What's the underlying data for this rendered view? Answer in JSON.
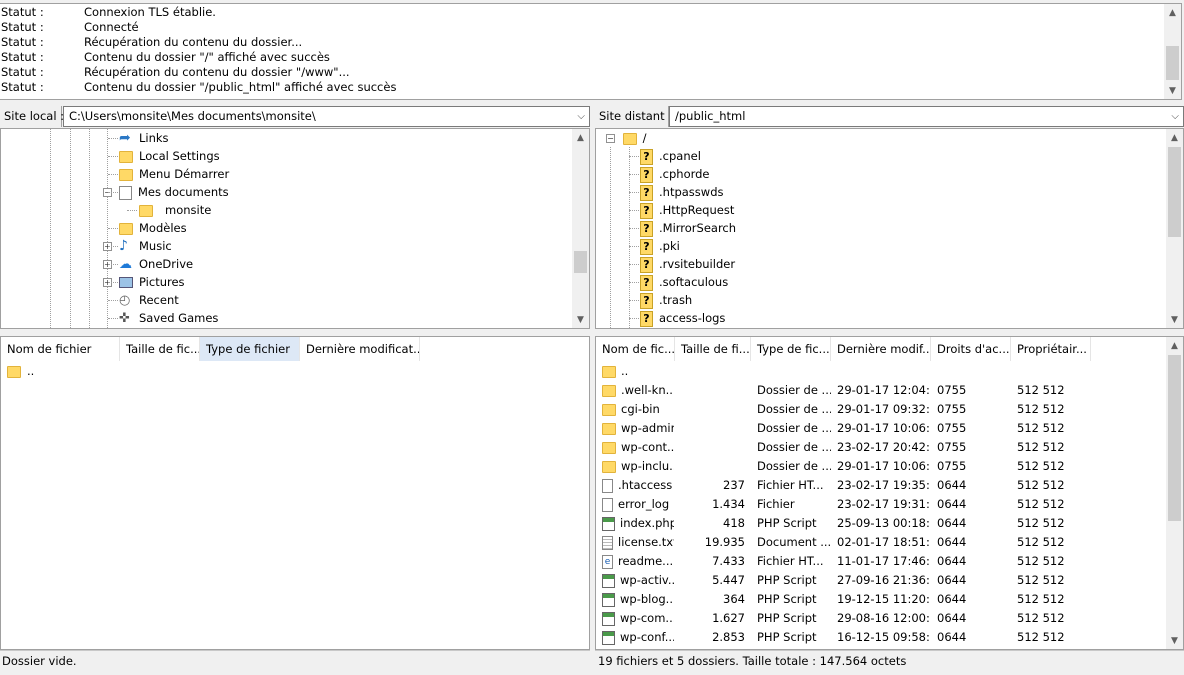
{
  "log": [
    {
      "key": "Statut :",
      "msg": "Connexion TLS établie."
    },
    {
      "key": "Statut :",
      "msg": "Connecté"
    },
    {
      "key": "Statut :",
      "msg": "Récupération du contenu du dossier..."
    },
    {
      "key": "Statut :",
      "msg": "Contenu du dossier \"/\" affiché avec succès"
    },
    {
      "key": "Statut :",
      "msg": "Récupération du contenu du dossier \"/www\"..."
    },
    {
      "key": "Statut :",
      "msg": "Contenu du dossier \"/public_html\" affiché avec succès"
    }
  ],
  "local": {
    "label": "Site local :",
    "path": "C:\\Users\\monsite\\Mes documents\\monsite\\",
    "tree": [
      {
        "label": "Links",
        "icon": "links-icon"
      },
      {
        "label": "Local Settings",
        "icon": "folder-icon"
      },
      {
        "label": "Menu Démarrer",
        "icon": "folder-icon"
      },
      {
        "label": "Mes documents",
        "icon": "documents-icon"
      },
      {
        "label": "monsite",
        "icon": "folder-icon"
      },
      {
        "label": "Modèles",
        "icon": "folder-icon"
      },
      {
        "label": "Music",
        "icon": "music-icon"
      },
      {
        "label": "OneDrive",
        "icon": "onedrive-icon"
      },
      {
        "label": "Pictures",
        "icon": "pictures-icon"
      },
      {
        "label": "Recent",
        "icon": "recent-icon"
      },
      {
        "label": "Saved Games",
        "icon": "saved-games-icon"
      }
    ],
    "columns": [
      "Nom de fichier",
      "Taille de fic...",
      "Type de fichier",
      "Dernière modificat..."
    ],
    "files": [
      ".."
    ],
    "status": "Dossier vide."
  },
  "remote": {
    "label": "Site distant :",
    "path": "/public_html",
    "tree_root": "/",
    "tree": [
      ".cpanel",
      ".cphorde",
      ".htpasswds",
      ".HttpRequest",
      ".MirrorSearch",
      ".pki",
      ".rvsitebuilder",
      ".softaculous",
      ".trash",
      "access-logs"
    ],
    "columns": [
      "Nom de fic...",
      "Taille de fi...",
      "Type de fic...",
      "Dernière modif...",
      "Droits d'ac...",
      "Propriétair..."
    ],
    "files": [
      {
        "name": "..",
        "size": "",
        "type": "",
        "date": "",
        "perm": "",
        "owner": "",
        "icon": "folder-icon"
      },
      {
        "name": ".well-kn...",
        "size": "",
        "type": "Dossier de ...",
        "date": "29-01-17 12:04:...",
        "perm": "0755",
        "owner": "512 512",
        "icon": "folder-icon"
      },
      {
        "name": "cgi-bin",
        "size": "",
        "type": "Dossier de ...",
        "date": "29-01-17 09:32:...",
        "perm": "0755",
        "owner": "512 512",
        "icon": "folder-icon"
      },
      {
        "name": "wp-admin",
        "size": "",
        "type": "Dossier de ...",
        "date": "29-01-17 10:06:...",
        "perm": "0755",
        "owner": "512 512",
        "icon": "folder-icon"
      },
      {
        "name": "wp-cont...",
        "size": "",
        "type": "Dossier de ...",
        "date": "23-02-17 20:42:...",
        "perm": "0755",
        "owner": "512 512",
        "icon": "folder-icon"
      },
      {
        "name": "wp-inclu...",
        "size": "",
        "type": "Dossier de ...",
        "date": "29-01-17 10:06:...",
        "perm": "0755",
        "owner": "512 512",
        "icon": "folder-icon"
      },
      {
        "name": ".htaccess",
        "size": "237",
        "type": "Fichier HT...",
        "date": "23-02-17 19:35:...",
        "perm": "0644",
        "owner": "512 512",
        "icon": "file-icon"
      },
      {
        "name": "error_log",
        "size": "1.434",
        "type": "Fichier",
        "date": "23-02-17 19:31:...",
        "perm": "0644",
        "owner": "512 512",
        "icon": "file-icon"
      },
      {
        "name": "index.php",
        "size": "418",
        "type": "PHP Script",
        "date": "25-09-13 00:18:...",
        "perm": "0644",
        "owner": "512 512",
        "icon": "php-icon"
      },
      {
        "name": "license.txt",
        "size": "19.935",
        "type": "Document ...",
        "date": "02-01-17 18:51:...",
        "perm": "0644",
        "owner": "512 512",
        "icon": "text-file-icon"
      },
      {
        "name": "readme....",
        "size": "7.433",
        "type": "Fichier HT...",
        "date": "11-01-17 17:46:...",
        "perm": "0644",
        "owner": "512 512",
        "icon": "html-file-icon"
      },
      {
        "name": "wp-activ...",
        "size": "5.447",
        "type": "PHP Script",
        "date": "27-09-16 21:36:...",
        "perm": "0644",
        "owner": "512 512",
        "icon": "php-icon"
      },
      {
        "name": "wp-blog...",
        "size": "364",
        "type": "PHP Script",
        "date": "19-12-15 11:20:...",
        "perm": "0644",
        "owner": "512 512",
        "icon": "php-icon"
      },
      {
        "name": "wp-com...",
        "size": "1.627",
        "type": "PHP Script",
        "date": "29-08-16 12:00:...",
        "perm": "0644",
        "owner": "512 512",
        "icon": "php-icon"
      },
      {
        "name": "wp-conf...",
        "size": "2.853",
        "type": "PHP Script",
        "date": "16-12-15 09:58:...",
        "perm": "0644",
        "owner": "512 512",
        "icon": "php-icon"
      }
    ],
    "status": "19 fichiers et 5 dossiers. Taille totale : 147.564 octets"
  }
}
